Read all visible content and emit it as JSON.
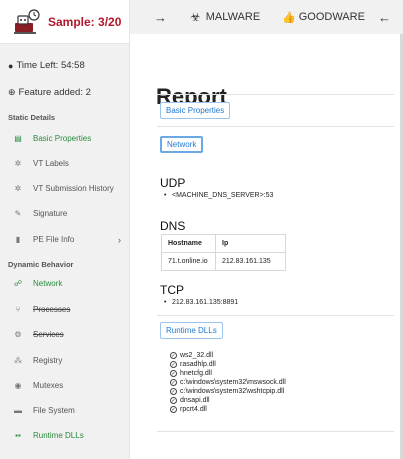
{
  "sidebar": {
    "sample": "Sample: 3/20",
    "time_left": "Time Left: 54:58",
    "feature_added": "Feature added: 2",
    "sections": {
      "static": "Static Details",
      "dynamic": "Dynamic Behavior"
    },
    "items": [
      {
        "label": "Basic Properties",
        "icon": "table-icon",
        "active": true
      },
      {
        "label": "VT Labels",
        "icon": "virus-icon"
      },
      {
        "label": "VT Submission History",
        "icon": "virus-icon"
      },
      {
        "label": "Signature",
        "icon": "signature-icon"
      },
      {
        "label": "PE File Info",
        "icon": "file-icon"
      },
      {
        "label": "Network",
        "icon": "network-icon",
        "active": true
      },
      {
        "label": "Processes",
        "icon": "process-icon",
        "struck": true
      },
      {
        "label": "Services",
        "icon": "cogs-icon",
        "struck": true
      },
      {
        "label": "Registry",
        "icon": "registry-icon"
      },
      {
        "label": "Mutexes",
        "icon": "mutex-icon"
      },
      {
        "label": "File System",
        "icon": "folder-icon"
      },
      {
        "label": "Runtime DLLs",
        "icon": "dll-icon",
        "active": true
      }
    ]
  },
  "topbar": {
    "malware": "MALWARE",
    "goodware": "GOODWARE"
  },
  "main": {
    "title": "Report",
    "buttons": {
      "basic_properties": "Basic Properties",
      "network": "Network",
      "runtime_dlls": "Runtime DLLs"
    },
    "udp": {
      "title": "UDP",
      "entries": [
        "<MACHINE_DNS_SERVER>:53"
      ]
    },
    "dns": {
      "title": "DNS",
      "headers": [
        "Hostname",
        "Ip"
      ],
      "rows": [
        [
          "71.t.online.io",
          "212.83.161.135"
        ]
      ]
    },
    "tcp": {
      "title": "TCP",
      "entries": [
        "212.83.161.135:8891"
      ]
    },
    "dlls": [
      "ws2_32.dll",
      "rasadhlp.dll",
      "hnetcfg.dll",
      "c:\\windows\\system32\\mswsock.dll",
      "c:\\windows\\system32\\wshtcpip.dll",
      "dnsapi.dll",
      "rpcrt4.dll"
    ]
  },
  "colors": {
    "accent_green": "#2b8a3e",
    "brand_red": "#b0172a",
    "link_blue": "#1f78d1"
  }
}
